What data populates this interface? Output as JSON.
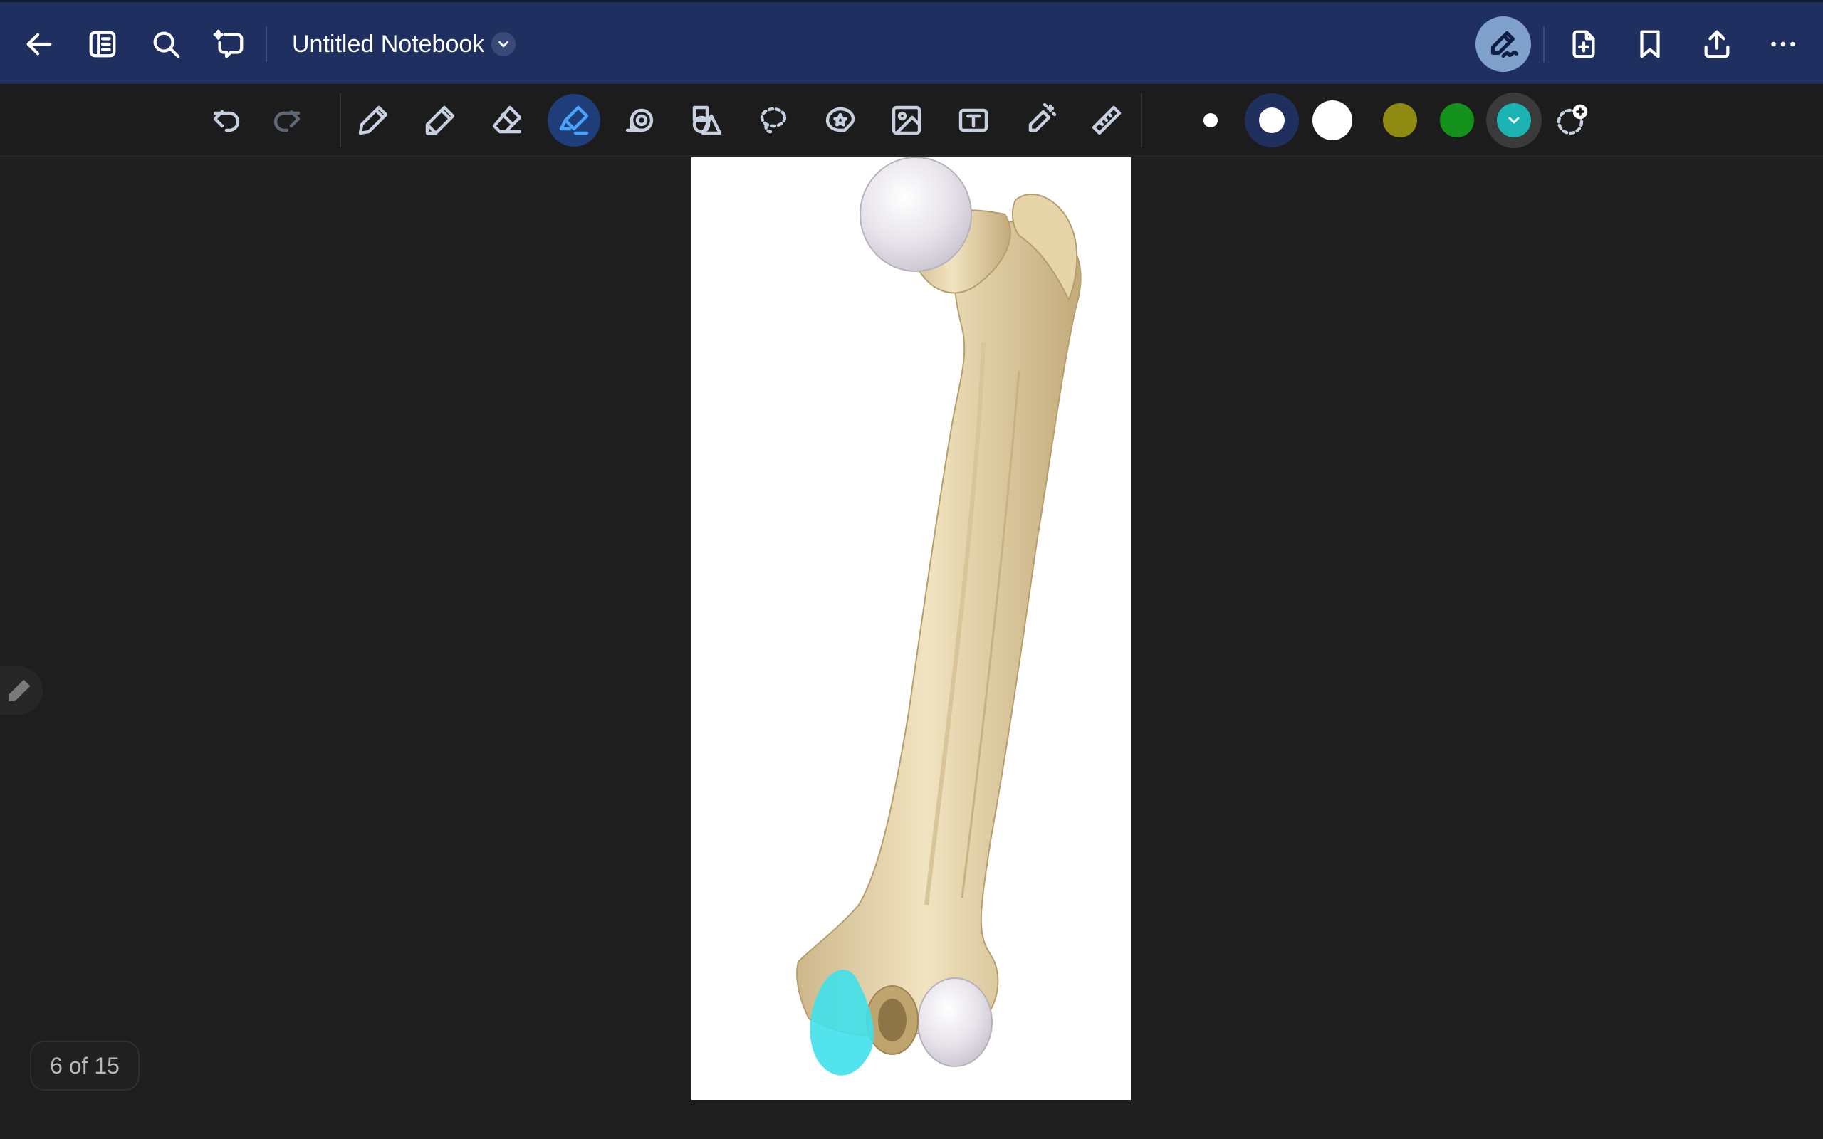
{
  "header": {
    "notebook_title": "Untitled Notebook",
    "left_icons": [
      "back-arrow-icon",
      "sidebar-toggle-icon",
      "search-icon",
      "ai-assistant-icon"
    ],
    "right_icons": [
      "pen-mode-icon",
      "add-page-icon",
      "bookmark-icon",
      "share-icon",
      "more-icon"
    ]
  },
  "toolbar": {
    "tools": [
      "undo",
      "redo",
      "pen",
      "pencil",
      "eraser",
      "highlighter",
      "tape",
      "shapes",
      "lasso",
      "sticker",
      "image",
      "text-box",
      "magic-pen",
      "ruler"
    ],
    "active_tool": "highlighter",
    "stroke_sizes": [
      "small",
      "medium",
      "large"
    ],
    "selected_size": "medium",
    "colors": [
      "#8f8a12",
      "#15921c",
      "#1bb2b4"
    ],
    "selected_color": "#1bb2b4"
  },
  "canvas": {
    "content": "femur-bone-illustration",
    "highlight_color": "#3fe0ea"
  },
  "footer": {
    "page_indicator": "6 of 15"
  }
}
